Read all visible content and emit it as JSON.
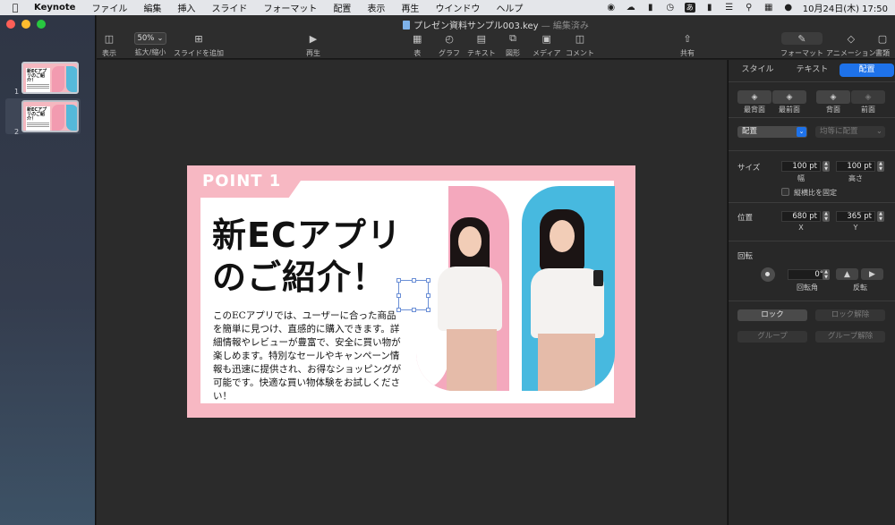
{
  "menubar": {
    "app": "Keynote",
    "items": [
      "ファイル",
      "編集",
      "挿入",
      "スライド",
      "フォーマット",
      "配置",
      "表示",
      "再生",
      "ウインドウ",
      "ヘルプ"
    ],
    "ime": "あ",
    "clock": "10月24日(木) 17:50"
  },
  "window": {
    "title": "プレゼン資料サンプル003.key",
    "title_sep": "—",
    "status": "編集済み"
  },
  "toolbar": {
    "view": "表示",
    "zoom_value": "50%",
    "zoom_label": "拡大/縮小",
    "add_slide": "スライドを追加",
    "play": "再生",
    "table": "表",
    "chart": "グラフ",
    "text": "テキスト",
    "shape": "図形",
    "media": "メディア",
    "comment": "コメント",
    "share": "共有",
    "format": "フォーマット",
    "animate": "アニメーション",
    "document": "書類"
  },
  "navigator": {
    "slides": [
      {
        "number": "1",
        "thumb_title": "新ECアプリのご紹介！"
      },
      {
        "number": "2",
        "thumb_title": "新ECアプリのご紹介！"
      }
    ]
  },
  "slide": {
    "point": "POINT 1",
    "headline_1": "新ECアプリ",
    "headline_2": "のご紹介！",
    "body": "このECアプリでは、ユーザーに合った商品を簡単に見つけ、直感的に購入できます。詳細情報やレビューが豊富で、安全に買い物が楽しめます。特別なセールやキャンペーン情報も迅速に提供され、お得なショッピングが可能です。快適な買い物体験をお試しください！",
    "colors": {
      "background": "#f7b8c3",
      "photo_left": "#f4a8bd",
      "photo_right": "#47b9df"
    }
  },
  "inspector": {
    "tabs": [
      "スタイル",
      "テキスト",
      "配置"
    ],
    "active_tab": "配置",
    "order_buttons": [
      "最背面",
      "最前面",
      "背面",
      "前面"
    ],
    "arrange_select": "配置",
    "distribute_select": "均等に配置",
    "size_label": "サイズ",
    "width_value": "100 pt",
    "width_label": "幅",
    "height_value": "100 pt",
    "height_label": "高さ",
    "constrain_label": "縦横比を固定",
    "position_label": "位置",
    "x_value": "680 pt",
    "x_label": "X",
    "y_value": "365 pt",
    "y_label": "Y",
    "rotate_label": "回転",
    "angle_value": "0°",
    "angle_label": "回転角",
    "flip_label": "反転",
    "lock": "ロック",
    "unlock": "ロック解除",
    "group": "グループ",
    "ungroup": "グループ解除"
  }
}
